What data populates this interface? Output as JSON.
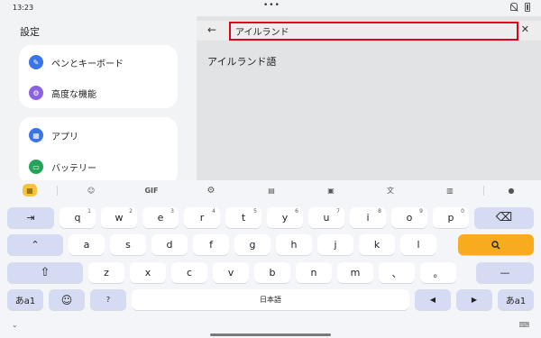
{
  "status": {
    "time": "13:23",
    "dots": "•••"
  },
  "settings": {
    "title": "設定",
    "items": [
      {
        "label": "ペンとキーボード",
        "icon": "pen-icon"
      },
      {
        "label": "高度な機能",
        "icon": "advanced-features-icon"
      },
      {
        "label": "アプリ",
        "icon": "apps-icon"
      },
      {
        "label": "バッテリー",
        "icon": "battery-icon"
      }
    ]
  },
  "search": {
    "query": "アイルランド",
    "back": "←",
    "clear": "✕"
  },
  "results": [
    "アイルランド語"
  ],
  "keyboard": {
    "toolbar": {
      "gif": "GIF"
    },
    "row1": [
      "q",
      "w",
      "e",
      "r",
      "t",
      "y",
      "u",
      "i",
      "o",
      "p"
    ],
    "row1_nums": [
      "1",
      "2",
      "3",
      "4",
      "5",
      "6",
      "7",
      "8",
      "9",
      "0"
    ],
    "row2": [
      "a",
      "s",
      "d",
      "f",
      "g",
      "h",
      "j",
      "k",
      "l"
    ],
    "row3": [
      "z",
      "x",
      "c",
      "v",
      "b",
      "n",
      "m",
      "、",
      "。"
    ],
    "tab": "⇥",
    "backspace": "⌫",
    "caps": "⌃",
    "shift": "⇧",
    "dash": "—",
    "lang_left": "あa1",
    "emoji": "☺",
    "question": "?",
    "space": "日本語",
    "left_arrow": "◀",
    "right_arrow": "▶",
    "lang_right": "あa1",
    "hide": "⌄",
    "switch": "⌨",
    "colors": {
      "enter": "#f6ac1e",
      "highlight": "#e4001c"
    }
  }
}
